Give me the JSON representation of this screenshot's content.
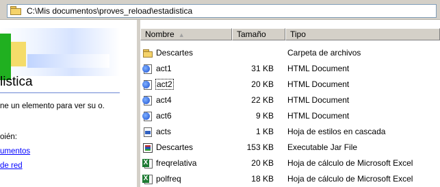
{
  "address": {
    "path": "C:\\Mis documentos\\proves_reload\\estadistica",
    "icon": "folder-icon"
  },
  "left_pane": {
    "title": "listica",
    "description": "ne un elemento para ver su o.",
    "see_also": "oién:",
    "links": [
      "umentos",
      " de red"
    ]
  },
  "columns": {
    "name": "Nombre",
    "size": "Tamaño",
    "type": "Tipo",
    "sort_indicator": "▲"
  },
  "files": [
    {
      "name": "Descartes",
      "size": "",
      "type": "Carpeta de archivos",
      "icon": "folder-icon"
    },
    {
      "name": "act1",
      "size": "31 KB",
      "type": "HTML Document",
      "icon": "html-document-icon"
    },
    {
      "name": "act2",
      "size": "20 KB",
      "type": "HTML Document",
      "icon": "html-document-icon"
    },
    {
      "name": "act4",
      "size": "22 KB",
      "type": "HTML Document",
      "icon": "html-document-icon"
    },
    {
      "name": "act6",
      "size": "9 KB",
      "type": "HTML Document",
      "icon": "html-document-icon"
    },
    {
      "name": "acts",
      "size": "1 KB",
      "type": "Hoja de estilos en cascada",
      "icon": "css-stylesheet-icon"
    },
    {
      "name": "Descartes",
      "size": "153 KB",
      "type": "Executable Jar File",
      "icon": "jar-file-icon"
    },
    {
      "name": "freqrelativa",
      "size": "20 KB",
      "type": "Hoja de cálculo de Microsoft Excel",
      "icon": "excel-spreadsheet-icon"
    },
    {
      "name": "polfreq",
      "size": "18 KB",
      "type": "Hoja de cálculo de Microsoft Excel",
      "icon": "excel-spreadsheet-icon"
    }
  ],
  "focused_index": 2
}
